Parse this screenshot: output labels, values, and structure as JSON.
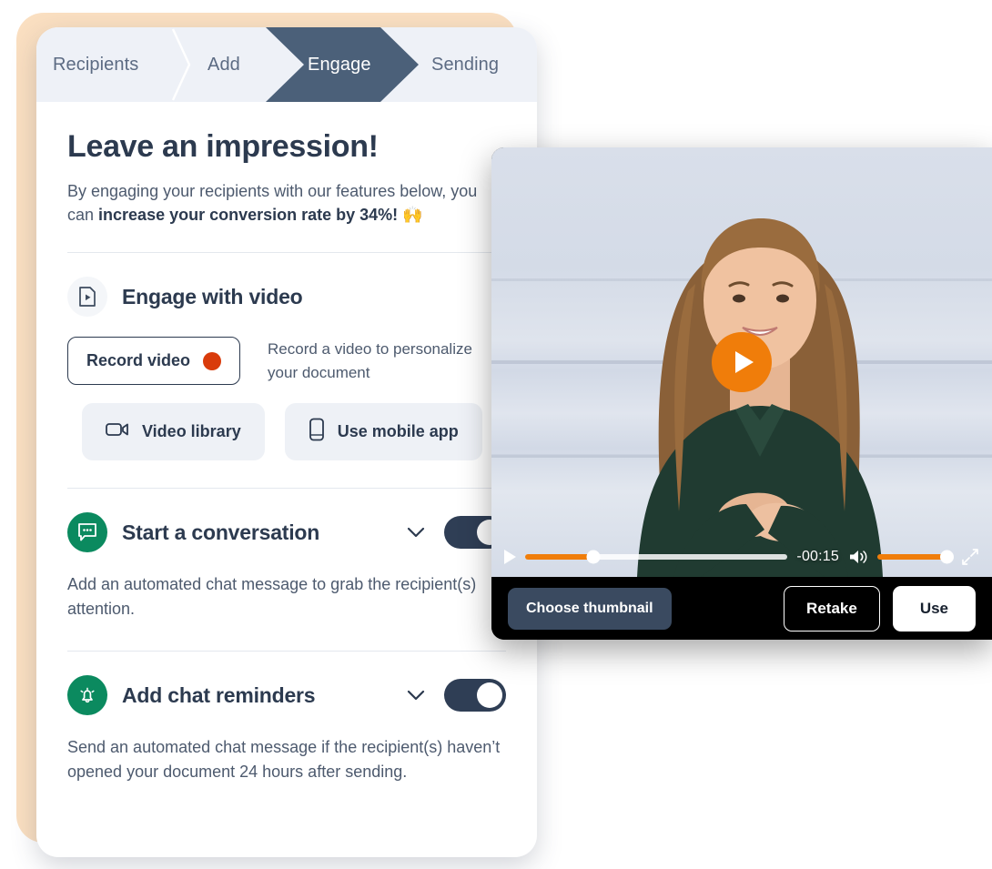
{
  "steps": [
    {
      "label": "Recipients",
      "active": false
    },
    {
      "label": "Add",
      "active": false
    },
    {
      "label": "Engage",
      "active": true
    },
    {
      "label": "Sending",
      "active": false
    }
  ],
  "page": {
    "title": "Leave an impression!",
    "subtitle_part1": "By engaging your recipients with our features below, you can ",
    "subtitle_bold": "increase your conversion rate by 34%!",
    "subtitle_emoji": "🙌"
  },
  "video_section": {
    "title": "Engage with video",
    "icon": "video-file-icon",
    "record_button": "Record video",
    "record_hint": "Record a video to personalize your document",
    "pills": [
      {
        "label": "Video library",
        "icon": "video-camera-icon"
      },
      {
        "label": "Use mobile app",
        "icon": "mobile-phone-icon"
      }
    ]
  },
  "conversation_section": {
    "title": "Start a conversation",
    "icon": "chat-bubble-icon",
    "description": "Add an automated chat message to grab the recipient(s) attention.",
    "toggle_on": true
  },
  "reminders_section": {
    "title": "Add chat reminders",
    "icon": "bell-icon",
    "description": "Send an automated chat message if the recipient(s) haven’t opened your document 24 hours after sending.",
    "toggle_on": true
  },
  "video_player": {
    "time_remaining": "-00:15",
    "progress_percent": 26,
    "volume_percent": 100,
    "play_icon": "play-icon",
    "volume_icon": "volume-icon",
    "fullscreen_icon": "fullscreen-icon",
    "actions": {
      "choose_thumbnail": "Choose thumbnail",
      "retake": "Retake",
      "use": "Use"
    }
  },
  "colors": {
    "accent_orange": "#f07d0a",
    "record_red": "#d93b0b",
    "dark_navy": "#2c3a4f",
    "green": "#0b8a5f",
    "peach": "#fadfc1",
    "step_bg": "#eef1f7"
  }
}
